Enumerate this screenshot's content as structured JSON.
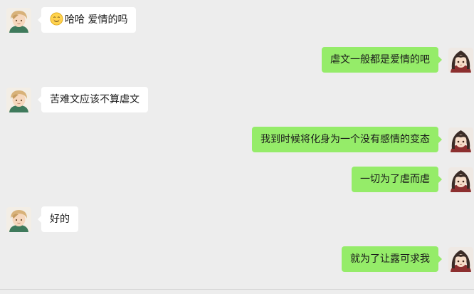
{
  "chat": {
    "messages": [
      {
        "side": "left",
        "emoji": "smiling-face-emoji",
        "text": "哈哈  爱情的吗"
      },
      {
        "side": "right",
        "text": "虐文一般都是爱情的吧"
      },
      {
        "side": "left",
        "text": "苦难文应该不算虐文"
      },
      {
        "side": "right",
        "text": "我到时候将化身为一个没有感情的变态"
      },
      {
        "side": "right",
        "text": "一切为了虐而虐"
      },
      {
        "side": "left",
        "text": "好的"
      },
      {
        "side": "right",
        "text": "就为了让露可求我"
      }
    ]
  },
  "colors": {
    "background": "#ededed",
    "incoming_bubble": "#ffffff",
    "outgoing_bubble": "#95ec69"
  },
  "icons": {
    "left_avatar": "blonde-boy-avatar",
    "right_avatar": "dark-haired-girl-avatar"
  }
}
